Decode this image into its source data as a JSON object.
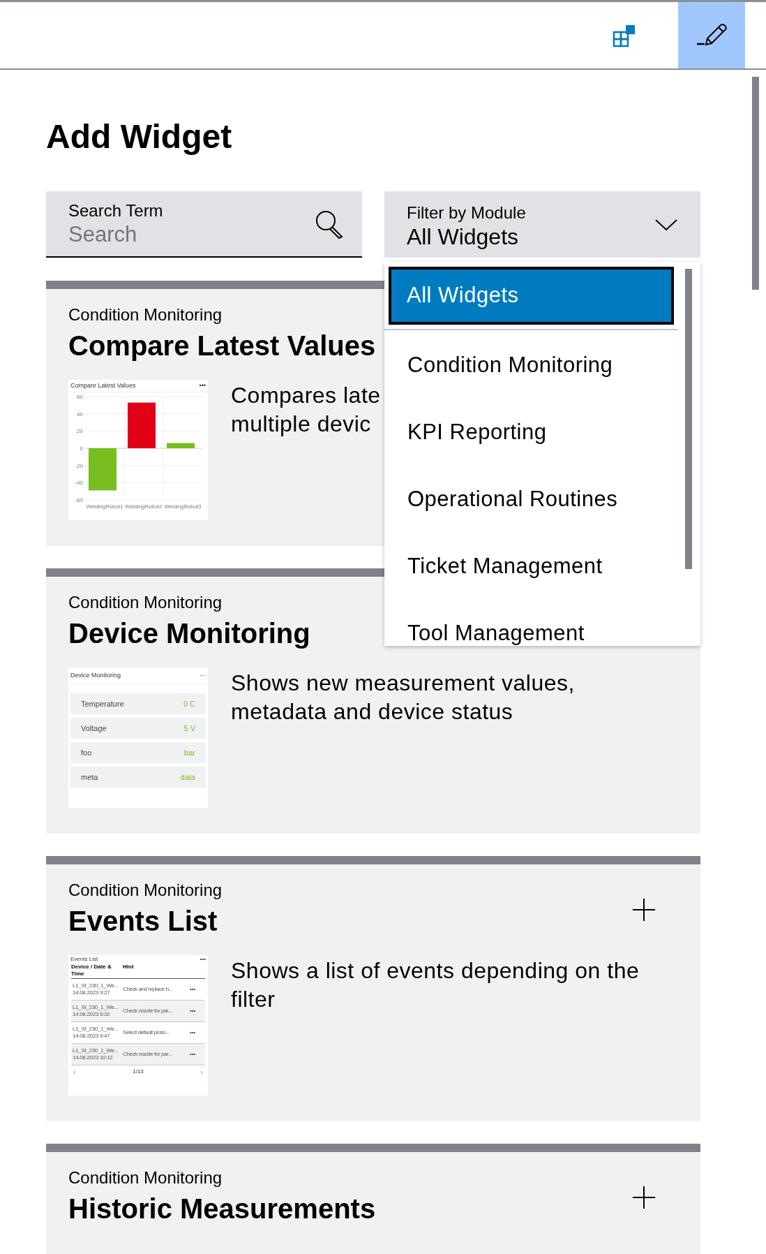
{
  "toolbar": {
    "edit_mode": true
  },
  "title": "Add Widget",
  "search": {
    "label": "Search Term",
    "placeholder": "Search"
  },
  "filter": {
    "label": "Filter by Module",
    "value": "All Widgets",
    "expanded": true,
    "options": [
      {
        "label": "All Widgets",
        "selected": true
      },
      {
        "label": "Condition Monitoring",
        "selected": false
      },
      {
        "label": "KPI Reporting",
        "selected": false
      },
      {
        "label": "Operational Routines",
        "selected": false
      },
      {
        "label": "Ticket Management",
        "selected": false
      },
      {
        "label": "Tool Management",
        "selected": false
      }
    ]
  },
  "widgets": [
    {
      "kind": "chart",
      "category": "Condition Monitoring",
      "title": "Compare Latest Values",
      "description_lines": [
        "Compares late",
        "multiple devic"
      ],
      "preview": {
        "title": "Compare Latest Values",
        "menu": "•••",
        "chart_data": {
          "type": "bar",
          "categories": [
            "WeldingRobot1",
            "WeldingRobot2",
            "WeldingRobot3"
          ],
          "values": [
            -49,
            53,
            6
          ],
          "colors": [
            "#78be20",
            "#e20015",
            "#78be20"
          ],
          "grid": true,
          "ylim": [
            -60,
            60
          ],
          "yticks": [
            -60,
            -40,
            -20,
            0,
            20,
            40,
            60
          ]
        }
      }
    },
    {
      "kind": "values",
      "category": "Condition Monitoring",
      "title": "Device Monitoring",
      "description_lines": [
        "Shows new measurement values,",
        "metadata and device status"
      ],
      "preview": {
        "title": "Device Monitoring",
        "menu": "···",
        "rows": [
          {
            "name": "Temperature",
            "value": "0 C"
          },
          {
            "name": "Voltage",
            "value": "5 V"
          },
          {
            "name": "foo",
            "value": "bar"
          },
          {
            "name": "meta",
            "value": "data"
          }
        ]
      }
    },
    {
      "kind": "events",
      "category": "Condition Monitoring",
      "title": "Events List",
      "description_lines": [
        "Shows a list of events depending on the",
        "filter"
      ],
      "add_icon": true,
      "preview": {
        "title": "Events List",
        "menu": "•••",
        "columns": [
          "Device / Date & Time",
          "Hint"
        ],
        "rows": [
          {
            "device": "L1_St_230_1_We...",
            "date": "14.08.2023 9:27",
            "hint": "Check and replace h...",
            "menu": "•••"
          },
          {
            "device": "L1_St_230_1_We...",
            "date": "14.08.2023 9:32",
            "hint": "Check nozzle for par...",
            "menu": "•••"
          },
          {
            "device": "L1_St_230_1_We...",
            "date": "14.08.2023 9:47",
            "hint": "Select default proto...",
            "menu": "•••"
          },
          {
            "device": "L1_St_230_1_We...",
            "date": "14.08.2023 10:12",
            "hint": "Check nozzle for par...",
            "menu": "•••"
          }
        ],
        "prev": "‹",
        "page": "1/13",
        "next": "›"
      }
    },
    {
      "kind": "cut",
      "category": "Condition Monitoring",
      "title": "Historic Measurements",
      "add_icon": true
    }
  ]
}
